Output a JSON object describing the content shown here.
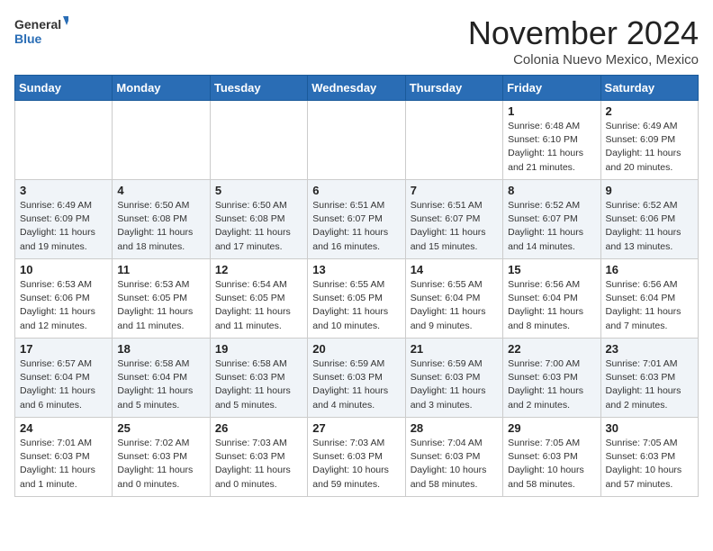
{
  "header": {
    "logo_general": "General",
    "logo_blue": "Blue",
    "month": "November 2024",
    "location": "Colonia Nuevo Mexico, Mexico"
  },
  "days_of_week": [
    "Sunday",
    "Monday",
    "Tuesday",
    "Wednesday",
    "Thursday",
    "Friday",
    "Saturday"
  ],
  "weeks": [
    [
      {
        "day": "",
        "info": ""
      },
      {
        "day": "",
        "info": ""
      },
      {
        "day": "",
        "info": ""
      },
      {
        "day": "",
        "info": ""
      },
      {
        "day": "",
        "info": ""
      },
      {
        "day": "1",
        "info": "Sunrise: 6:48 AM\nSunset: 6:10 PM\nDaylight: 11 hours\nand 21 minutes."
      },
      {
        "day": "2",
        "info": "Sunrise: 6:49 AM\nSunset: 6:09 PM\nDaylight: 11 hours\nand 20 minutes."
      }
    ],
    [
      {
        "day": "3",
        "info": "Sunrise: 6:49 AM\nSunset: 6:09 PM\nDaylight: 11 hours\nand 19 minutes."
      },
      {
        "day": "4",
        "info": "Sunrise: 6:50 AM\nSunset: 6:08 PM\nDaylight: 11 hours\nand 18 minutes."
      },
      {
        "day": "5",
        "info": "Sunrise: 6:50 AM\nSunset: 6:08 PM\nDaylight: 11 hours\nand 17 minutes."
      },
      {
        "day": "6",
        "info": "Sunrise: 6:51 AM\nSunset: 6:07 PM\nDaylight: 11 hours\nand 16 minutes."
      },
      {
        "day": "7",
        "info": "Sunrise: 6:51 AM\nSunset: 6:07 PM\nDaylight: 11 hours\nand 15 minutes."
      },
      {
        "day": "8",
        "info": "Sunrise: 6:52 AM\nSunset: 6:07 PM\nDaylight: 11 hours\nand 14 minutes."
      },
      {
        "day": "9",
        "info": "Sunrise: 6:52 AM\nSunset: 6:06 PM\nDaylight: 11 hours\nand 13 minutes."
      }
    ],
    [
      {
        "day": "10",
        "info": "Sunrise: 6:53 AM\nSunset: 6:06 PM\nDaylight: 11 hours\nand 12 minutes."
      },
      {
        "day": "11",
        "info": "Sunrise: 6:53 AM\nSunset: 6:05 PM\nDaylight: 11 hours\nand 11 minutes."
      },
      {
        "day": "12",
        "info": "Sunrise: 6:54 AM\nSunset: 6:05 PM\nDaylight: 11 hours\nand 11 minutes."
      },
      {
        "day": "13",
        "info": "Sunrise: 6:55 AM\nSunset: 6:05 PM\nDaylight: 11 hours\nand 10 minutes."
      },
      {
        "day": "14",
        "info": "Sunrise: 6:55 AM\nSunset: 6:04 PM\nDaylight: 11 hours\nand 9 minutes."
      },
      {
        "day": "15",
        "info": "Sunrise: 6:56 AM\nSunset: 6:04 PM\nDaylight: 11 hours\nand 8 minutes."
      },
      {
        "day": "16",
        "info": "Sunrise: 6:56 AM\nSunset: 6:04 PM\nDaylight: 11 hours\nand 7 minutes."
      }
    ],
    [
      {
        "day": "17",
        "info": "Sunrise: 6:57 AM\nSunset: 6:04 PM\nDaylight: 11 hours\nand 6 minutes."
      },
      {
        "day": "18",
        "info": "Sunrise: 6:58 AM\nSunset: 6:04 PM\nDaylight: 11 hours\nand 5 minutes."
      },
      {
        "day": "19",
        "info": "Sunrise: 6:58 AM\nSunset: 6:03 PM\nDaylight: 11 hours\nand 5 minutes."
      },
      {
        "day": "20",
        "info": "Sunrise: 6:59 AM\nSunset: 6:03 PM\nDaylight: 11 hours\nand 4 minutes."
      },
      {
        "day": "21",
        "info": "Sunrise: 6:59 AM\nSunset: 6:03 PM\nDaylight: 11 hours\nand 3 minutes."
      },
      {
        "day": "22",
        "info": "Sunrise: 7:00 AM\nSunset: 6:03 PM\nDaylight: 11 hours\nand 2 minutes."
      },
      {
        "day": "23",
        "info": "Sunrise: 7:01 AM\nSunset: 6:03 PM\nDaylight: 11 hours\nand 2 minutes."
      }
    ],
    [
      {
        "day": "24",
        "info": "Sunrise: 7:01 AM\nSunset: 6:03 PM\nDaylight: 11 hours\nand 1 minute."
      },
      {
        "day": "25",
        "info": "Sunrise: 7:02 AM\nSunset: 6:03 PM\nDaylight: 11 hours\nand 0 minutes."
      },
      {
        "day": "26",
        "info": "Sunrise: 7:03 AM\nSunset: 6:03 PM\nDaylight: 11 hours\nand 0 minutes."
      },
      {
        "day": "27",
        "info": "Sunrise: 7:03 AM\nSunset: 6:03 PM\nDaylight: 10 hours\nand 59 minutes."
      },
      {
        "day": "28",
        "info": "Sunrise: 7:04 AM\nSunset: 6:03 PM\nDaylight: 10 hours\nand 58 minutes."
      },
      {
        "day": "29",
        "info": "Sunrise: 7:05 AM\nSunset: 6:03 PM\nDaylight: 10 hours\nand 58 minutes."
      },
      {
        "day": "30",
        "info": "Sunrise: 7:05 AM\nSunset: 6:03 PM\nDaylight: 10 hours\nand 57 minutes."
      }
    ]
  ]
}
